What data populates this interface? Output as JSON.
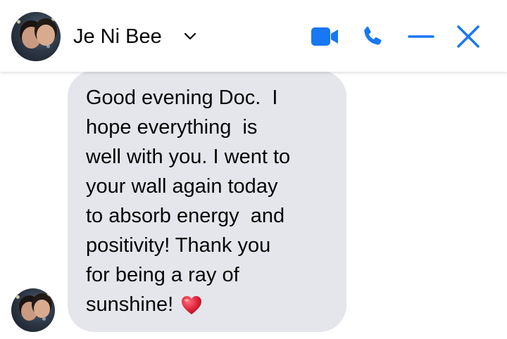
{
  "header": {
    "contact_name": "Je Ni Bee",
    "avatar": "contact-avatar",
    "name_chevron": "chevron-down-icon",
    "actions": [
      {
        "name": "video-call-icon"
      },
      {
        "name": "phone-icon"
      },
      {
        "name": "minimize-icon"
      },
      {
        "name": "close-icon"
      }
    ]
  },
  "message": {
    "lines": [
      "Good evening Doc.  I",
      "hope everything  is",
      "well with you. I went to",
      "your wall again today",
      "to absorb energy  and",
      "positivity! Thank you",
      "for being a ray of",
      "sunshine! "
    ],
    "emoji": "heart-icon"
  },
  "colors": {
    "accent": "#1877f2",
    "bubble": "#e4e6eb",
    "text": "#050505",
    "heart": "#e0243a"
  }
}
